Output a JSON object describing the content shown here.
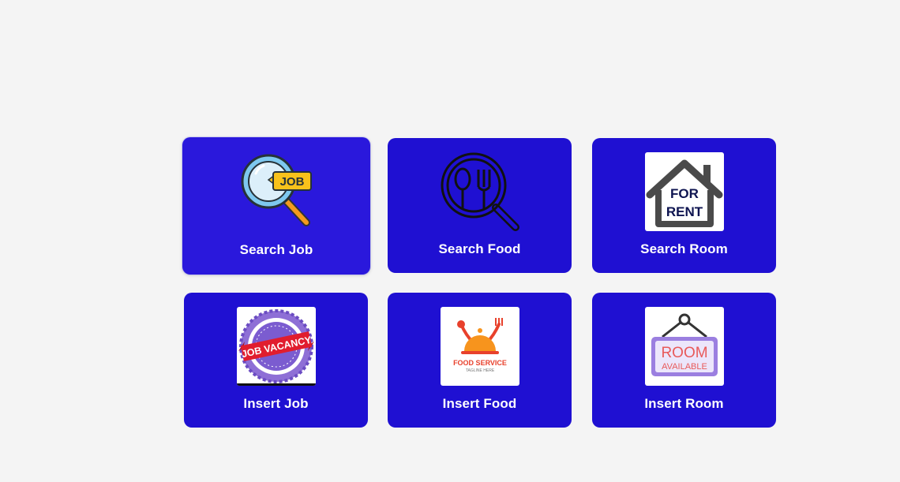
{
  "cards": [
    {
      "label": "Search Job",
      "icon": "job-search-icon"
    },
    {
      "label": "Search Food",
      "icon": "food-search-icon"
    },
    {
      "label": "Search Room",
      "icon": "for-rent-sign-icon"
    },
    {
      "label": "Insert Job",
      "icon": "job-vacancy-stamp-icon"
    },
    {
      "label": "Insert Food",
      "icon": "food-service-logo-icon"
    },
    {
      "label": "Insert Room",
      "icon": "room-available-sign-icon"
    }
  ],
  "icon_text": {
    "job": "JOB",
    "for": "FOR",
    "rent": "RENT",
    "vacancy": "JOB VACANCY",
    "food_service": "FOOD SERVICE",
    "tagline": "TAGLINE HERE",
    "room": "ROOM",
    "available": "AVAILABLE"
  },
  "colors": {
    "background": "#f4f4f4",
    "card": "#1f10d2",
    "card_active": "#2a18dc",
    "text": "#ffffff"
  }
}
